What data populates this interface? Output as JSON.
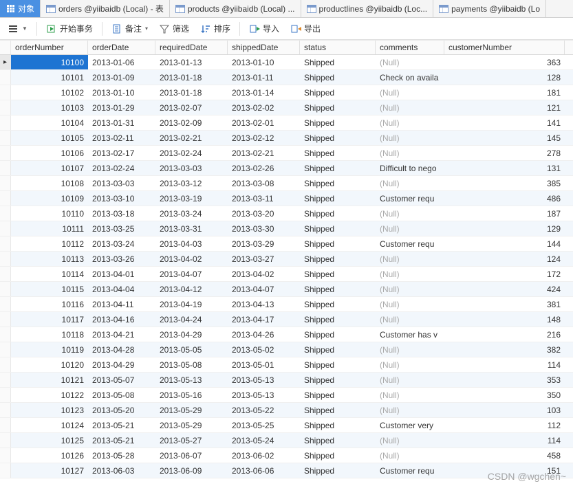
{
  "tabs": [
    {
      "label": "对象",
      "type": "objects",
      "active": true
    },
    {
      "label": "orders @yiibaidb (Local) - 表",
      "type": "table"
    },
    {
      "label": "products @yiibaidb (Local) ...",
      "type": "table"
    },
    {
      "label": "productlines @yiibaidb (Loc...",
      "type": "table"
    },
    {
      "label": "payments @yiibaidb (Lo",
      "type": "table"
    }
  ],
  "toolbar": {
    "begin_tx": "开始事务",
    "memo": "备注",
    "filter": "筛选",
    "sort": "排序",
    "import": "导入",
    "export": "导出"
  },
  "columns": [
    "orderNumber",
    "orderDate",
    "requiredDate",
    "shippedDate",
    "status",
    "comments",
    "customerNumber"
  ],
  "null_text": "(Null)",
  "rows": [
    {
      "orderNumber": "10100",
      "orderDate": "2013-01-06",
      "requiredDate": "2013-01-13",
      "shippedDate": "2013-01-10",
      "status": "Shipped",
      "comments": null,
      "customerNumber": "363"
    },
    {
      "orderNumber": "10101",
      "orderDate": "2013-01-09",
      "requiredDate": "2013-01-18",
      "shippedDate": "2013-01-11",
      "status": "Shipped",
      "comments": "Check on availa",
      "customerNumber": "128"
    },
    {
      "orderNumber": "10102",
      "orderDate": "2013-01-10",
      "requiredDate": "2013-01-18",
      "shippedDate": "2013-01-14",
      "status": "Shipped",
      "comments": null,
      "customerNumber": "181"
    },
    {
      "orderNumber": "10103",
      "orderDate": "2013-01-29",
      "requiredDate": "2013-02-07",
      "shippedDate": "2013-02-02",
      "status": "Shipped",
      "comments": null,
      "customerNumber": "121"
    },
    {
      "orderNumber": "10104",
      "orderDate": "2013-01-31",
      "requiredDate": "2013-02-09",
      "shippedDate": "2013-02-01",
      "status": "Shipped",
      "comments": null,
      "customerNumber": "141"
    },
    {
      "orderNumber": "10105",
      "orderDate": "2013-02-11",
      "requiredDate": "2013-02-21",
      "shippedDate": "2013-02-12",
      "status": "Shipped",
      "comments": null,
      "customerNumber": "145"
    },
    {
      "orderNumber": "10106",
      "orderDate": "2013-02-17",
      "requiredDate": "2013-02-24",
      "shippedDate": "2013-02-21",
      "status": "Shipped",
      "comments": null,
      "customerNumber": "278"
    },
    {
      "orderNumber": "10107",
      "orderDate": "2013-02-24",
      "requiredDate": "2013-03-03",
      "shippedDate": "2013-02-26",
      "status": "Shipped",
      "comments": "Difficult to nego",
      "customerNumber": "131"
    },
    {
      "orderNumber": "10108",
      "orderDate": "2013-03-03",
      "requiredDate": "2013-03-12",
      "shippedDate": "2013-03-08",
      "status": "Shipped",
      "comments": null,
      "customerNumber": "385"
    },
    {
      "orderNumber": "10109",
      "orderDate": "2013-03-10",
      "requiredDate": "2013-03-19",
      "shippedDate": "2013-03-11",
      "status": "Shipped",
      "comments": "Customer requ",
      "customerNumber": "486"
    },
    {
      "orderNumber": "10110",
      "orderDate": "2013-03-18",
      "requiredDate": "2013-03-24",
      "shippedDate": "2013-03-20",
      "status": "Shipped",
      "comments": null,
      "customerNumber": "187"
    },
    {
      "orderNumber": "10111",
      "orderDate": "2013-03-25",
      "requiredDate": "2013-03-31",
      "shippedDate": "2013-03-30",
      "status": "Shipped",
      "comments": null,
      "customerNumber": "129"
    },
    {
      "orderNumber": "10112",
      "orderDate": "2013-03-24",
      "requiredDate": "2013-04-03",
      "shippedDate": "2013-03-29",
      "status": "Shipped",
      "comments": "Customer requ",
      "customerNumber": "144"
    },
    {
      "orderNumber": "10113",
      "orderDate": "2013-03-26",
      "requiredDate": "2013-04-02",
      "shippedDate": "2013-03-27",
      "status": "Shipped",
      "comments": null,
      "customerNumber": "124"
    },
    {
      "orderNumber": "10114",
      "orderDate": "2013-04-01",
      "requiredDate": "2013-04-07",
      "shippedDate": "2013-04-02",
      "status": "Shipped",
      "comments": null,
      "customerNumber": "172"
    },
    {
      "orderNumber": "10115",
      "orderDate": "2013-04-04",
      "requiredDate": "2013-04-12",
      "shippedDate": "2013-04-07",
      "status": "Shipped",
      "comments": null,
      "customerNumber": "424"
    },
    {
      "orderNumber": "10116",
      "orderDate": "2013-04-11",
      "requiredDate": "2013-04-19",
      "shippedDate": "2013-04-13",
      "status": "Shipped",
      "comments": null,
      "customerNumber": "381"
    },
    {
      "orderNumber": "10117",
      "orderDate": "2013-04-16",
      "requiredDate": "2013-04-24",
      "shippedDate": "2013-04-17",
      "status": "Shipped",
      "comments": null,
      "customerNumber": "148"
    },
    {
      "orderNumber": "10118",
      "orderDate": "2013-04-21",
      "requiredDate": "2013-04-29",
      "shippedDate": "2013-04-26",
      "status": "Shipped",
      "comments": "Customer has v",
      "customerNumber": "216"
    },
    {
      "orderNumber": "10119",
      "orderDate": "2013-04-28",
      "requiredDate": "2013-05-05",
      "shippedDate": "2013-05-02",
      "status": "Shipped",
      "comments": null,
      "customerNumber": "382"
    },
    {
      "orderNumber": "10120",
      "orderDate": "2013-04-29",
      "requiredDate": "2013-05-08",
      "shippedDate": "2013-05-01",
      "status": "Shipped",
      "comments": null,
      "customerNumber": "114"
    },
    {
      "orderNumber": "10121",
      "orderDate": "2013-05-07",
      "requiredDate": "2013-05-13",
      "shippedDate": "2013-05-13",
      "status": "Shipped",
      "comments": null,
      "customerNumber": "353"
    },
    {
      "orderNumber": "10122",
      "orderDate": "2013-05-08",
      "requiredDate": "2013-05-16",
      "shippedDate": "2013-05-13",
      "status": "Shipped",
      "comments": null,
      "customerNumber": "350"
    },
    {
      "orderNumber": "10123",
      "orderDate": "2013-05-20",
      "requiredDate": "2013-05-29",
      "shippedDate": "2013-05-22",
      "status": "Shipped",
      "comments": null,
      "customerNumber": "103"
    },
    {
      "orderNumber": "10124",
      "orderDate": "2013-05-21",
      "requiredDate": "2013-05-29",
      "shippedDate": "2013-05-25",
      "status": "Shipped",
      "comments": "Customer very",
      "customerNumber": "112"
    },
    {
      "orderNumber": "10125",
      "orderDate": "2013-05-21",
      "requiredDate": "2013-05-27",
      "shippedDate": "2013-05-24",
      "status": "Shipped",
      "comments": null,
      "customerNumber": "114"
    },
    {
      "orderNumber": "10126",
      "orderDate": "2013-05-28",
      "requiredDate": "2013-06-07",
      "shippedDate": "2013-06-02",
      "status": "Shipped",
      "comments": null,
      "customerNumber": "458"
    },
    {
      "orderNumber": "10127",
      "orderDate": "2013-06-03",
      "requiredDate": "2013-06-09",
      "shippedDate": "2013-06-06",
      "status": "Shipped",
      "comments": "Customer requ",
      "customerNumber": "151"
    }
  ],
  "watermark": "CSDN @wgchen~"
}
